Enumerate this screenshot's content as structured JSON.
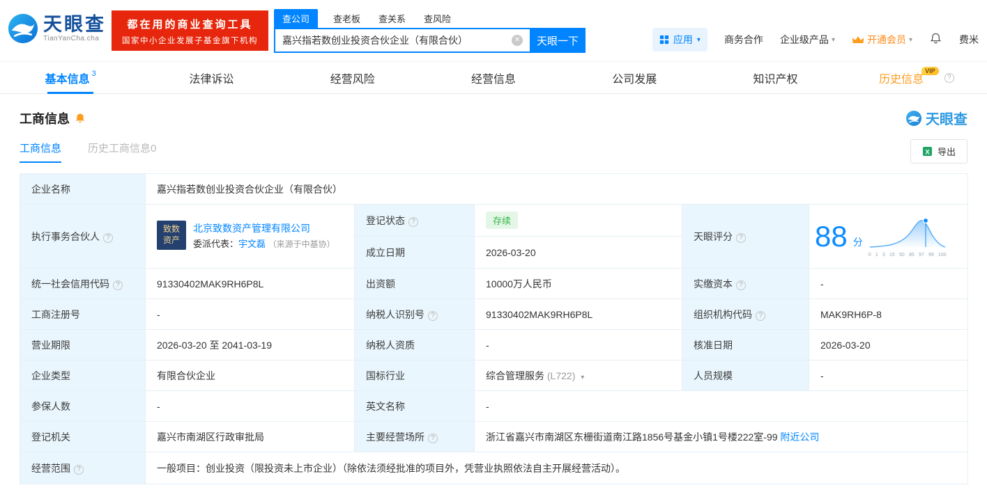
{
  "icons": {
    "question": "?",
    "clear": "✕",
    "caret_down": "▾",
    "vip": "VIP",
    "excel": "X"
  },
  "header": {
    "logo": {
      "name": "天眼查",
      "sub": "TianYanCha.cha"
    },
    "slogan": {
      "line1": "都在用的商业查询工具",
      "line2": "国家中小企业发展子基金旗下机构"
    },
    "search_tabs": [
      {
        "label": "查公司"
      },
      {
        "label": "查老板"
      },
      {
        "label": "查关系"
      },
      {
        "label": "查风险"
      }
    ],
    "search": {
      "value": "嘉兴指若数创业投资合伙企业（有限合伙）",
      "button": "天眼一下"
    },
    "nav": {
      "app": "应用",
      "cooperation": "商务合作",
      "enterprise": "企业级产品",
      "member": "开通会员",
      "user": "费米"
    }
  },
  "tabs": {
    "basic": {
      "label": "基本信息",
      "count": "3"
    },
    "legal": {
      "label": "法律诉讼"
    },
    "risk": {
      "label": "经营风险"
    },
    "operation": {
      "label": "经营信息"
    },
    "development": {
      "label": "公司发展"
    },
    "ip": {
      "label": "知识产权"
    },
    "history": {
      "label": "历史信息"
    }
  },
  "section": {
    "title": "工商信息",
    "watermark": "天眼查",
    "sub_tabs": {
      "current": {
        "label": "工商信息"
      },
      "history": {
        "label": "历史工商信息",
        "count": "0"
      }
    },
    "export": "导出"
  },
  "info": {
    "company_name": {
      "label": "企业名称",
      "value": "嘉兴指若数创业投资合伙企业（有限合伙）"
    },
    "partner": {
      "label": "执行事务合伙人",
      "logo_line1": "致数",
      "logo_line2": "资产",
      "company": "北京致数资产管理有限公司",
      "rep_label": "委派代表：",
      "rep_name": "宇文磊",
      "rep_source": "（来源于中基协）"
    },
    "reg_status": {
      "label": "登记状态",
      "value": "存续"
    },
    "establish_date": {
      "label": "成立日期",
      "value": "2026-03-20"
    },
    "score": {
      "label": "天眼评分",
      "value": "88",
      "unit": "分",
      "axis_ticks": [
        "0",
        "1",
        "3",
        "15",
        "50",
        "85",
        "97",
        "99",
        "100"
      ]
    },
    "credit_code": {
      "label": "统一社会信用代码",
      "value": "91330402MAK9RH6P8L"
    },
    "capital": {
      "label": "出资额",
      "value": "10000万人民币"
    },
    "paid_capital": {
      "label": "实缴资本",
      "value": "-"
    },
    "reg_number": {
      "label": "工商注册号",
      "value": "-"
    },
    "taxpayer_id": {
      "label": "纳税人识别号",
      "value": "91330402MAK9RH6P8L"
    },
    "org_code": {
      "label": "组织机构代码",
      "value": "MAK9RH6P-8"
    },
    "business_term": {
      "label": "营业期限",
      "value": "2026-03-20 至 2041-03-19"
    },
    "taxpayer_quality": {
      "label": "纳税人资质",
      "value": "-"
    },
    "approval_date": {
      "label": "核准日期",
      "value": "2026-03-20"
    },
    "company_type": {
      "label": "企业类型",
      "value": "有限合伙企业"
    },
    "industry": {
      "label": "国标行业",
      "value": "综合管理服务",
      "code": "(L722)"
    },
    "staff_size": {
      "label": "人员规模",
      "value": "-"
    },
    "insured_count": {
      "label": "参保人数",
      "value": "-"
    },
    "english_name": {
      "label": "英文名称",
      "value": "-"
    },
    "reg_authority": {
      "label": "登记机关",
      "value": "嘉兴市南湖区行政审批局"
    },
    "premises": {
      "label": "主要经营场所",
      "value": "浙江省嘉兴市南湖区东栅街道南江路1856号基金小镇1号楼222室-99",
      "link": "附近公司"
    },
    "business_scope": {
      "label": "经营范围",
      "value": "一般项目：创业投资（限投资未上市企业）（除依法须经批准的项目外，凭营业执照依法自主开展经营活动）。"
    }
  }
}
